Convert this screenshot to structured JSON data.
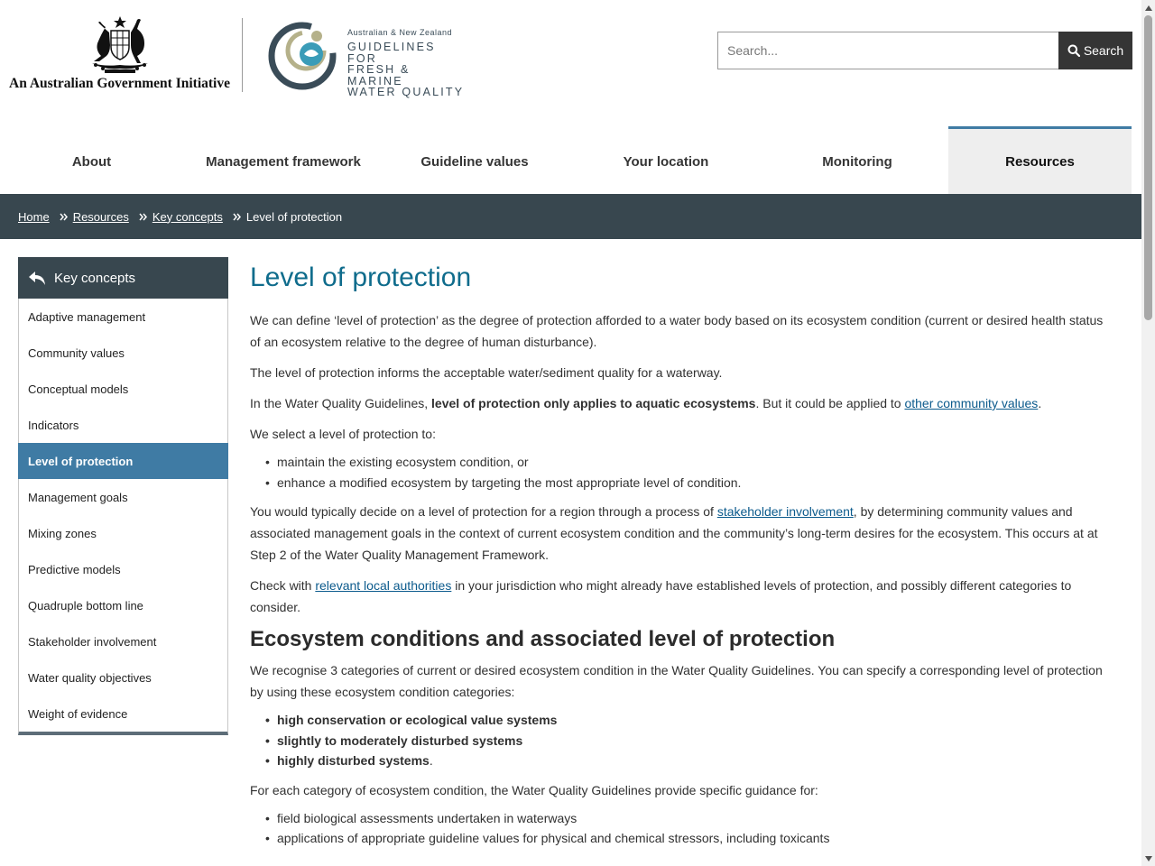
{
  "header": {
    "gov_initiative": "An Australian Government Initiative",
    "wq_logo": {
      "line1": "Australian & New Zealand",
      "line2": "GUIDELINES FOR",
      "line3": "FRESH & MARINE",
      "line4": "WATER QUALITY"
    },
    "search": {
      "placeholder": "Search...",
      "button_label": "Search"
    }
  },
  "nav": {
    "items": [
      {
        "label": "About"
      },
      {
        "label": "Management framework"
      },
      {
        "label": "Guideline values"
      },
      {
        "label": "Your location"
      },
      {
        "label": "Monitoring"
      },
      {
        "label": "Resources",
        "active": true
      }
    ]
  },
  "breadcrumb": {
    "items": [
      "Home",
      "Resources",
      "Key concepts"
    ],
    "current": "Level of protection"
  },
  "sidebar": {
    "title": "Key concepts",
    "items": [
      "Adaptive management",
      "Community values",
      "Conceptual models",
      "Indicators",
      "Level of protection",
      "Management goals",
      "Mixing zones",
      "Predictive models",
      "Quadruple bottom line",
      "Stakeholder involvement",
      "Water quality objectives",
      "Weight of evidence"
    ],
    "active_index": 4
  },
  "main": {
    "title": "Level of protection",
    "p1": "We can define ‘level of protection’ as the degree of protection afforded to a water body based on its ecosystem condition (current or desired health status of an ecosystem relative to the degree of human disturbance).",
    "p2": "The level of protection informs the acceptable water/sediment quality for a waterway.",
    "p3": {
      "pre": "In the Water Quality Guidelines, ",
      "bold": "level of protection only applies to aquatic ecosystems",
      "mid": ". But it could be applied to ",
      "link": "other community values",
      "post": "."
    },
    "p4": "We select a level of protection to:",
    "list1": [
      "maintain the existing ecosystem condition, or",
      "enhance a modified ecosystem by targeting the most appropriate level of condition."
    ],
    "p5": {
      "pre": "You would typically decide on a level of protection for a region through a process of ",
      "link": "stakeholder involvement",
      "post": ", by determining community values and associated management goals in the context of current ecosystem condition and the community’s long-term desires for the ecosystem. This occurs at at Step 2 of the Water Quality Management Framework."
    },
    "p6": {
      "pre": "Check with ",
      "link": "relevant local authorities",
      "post": " in your jurisdiction who might already have established levels of protection, and possibly different categories to consider."
    },
    "section_heading": "Ecosystem conditions and associated level of protection",
    "p7": "We recognise 3 categories of current or desired ecosystem condition in the Water Quality Guidelines. You can specify a corresponding level of protection by using these ecosystem condition categories:",
    "list2": [
      "high conservation or ecological value systems",
      "slightly to moderately disturbed systems",
      "highly disturbed systems"
    ],
    "list2_last_suffix": ".",
    "p8": "For each category of ecosystem condition, the Water Quality Guidelines provide specific guidance for:",
    "list3": [
      "field biological assessments undertaken in waterways",
      "applications of appropriate guideline values for physical and chemical stressors, including toxicants"
    ]
  }
}
